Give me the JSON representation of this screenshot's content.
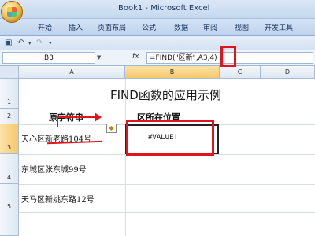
{
  "window": {
    "title": "Book1 - Microsoft Excel"
  },
  "ribbon": {
    "tabs": [
      "开始",
      "插入",
      "页面布局",
      "公式",
      "数据",
      "审阅",
      "视图",
      "开发工具"
    ]
  },
  "formula_bar": {
    "cell_ref": "B3",
    "fx": "fx",
    "formula": "=FIND(\"区新\",A3,4)"
  },
  "columns": [
    "A",
    "B",
    "C",
    "D"
  ],
  "rows": [
    "1",
    "2",
    "3",
    "4",
    "5"
  ],
  "sheet": {
    "title": "FIND函数的应用示例",
    "header_a": "原字符串",
    "header_b": "区所在位置",
    "a3": "天心区新老路104号",
    "b3": "#VALUE!",
    "a4": "东城区张东城99号",
    "a5": "天马区新姚东路12号"
  },
  "colors": {
    "annotation": "#e0141c"
  }
}
